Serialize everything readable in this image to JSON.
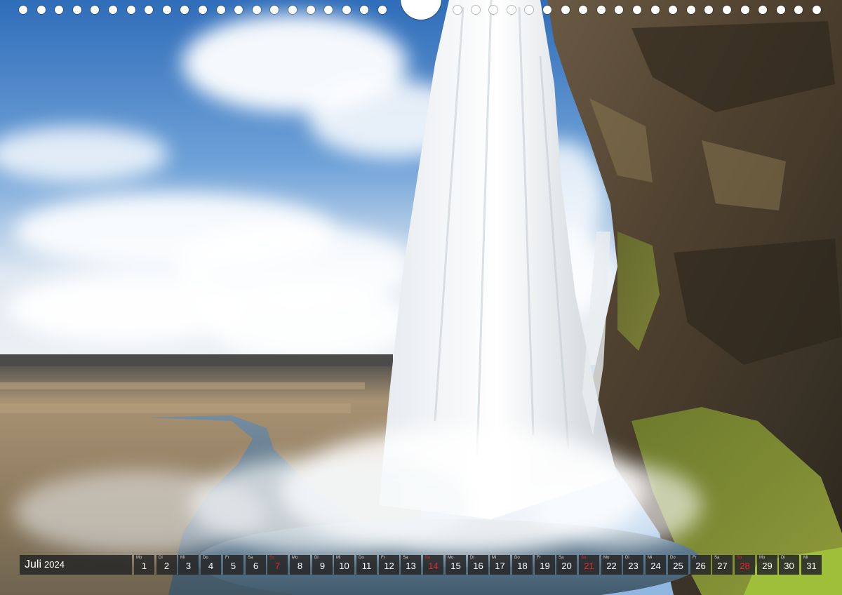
{
  "calendar": {
    "month": "Juli",
    "year": "2024",
    "days": [
      {
        "wd": "Mo",
        "d": "1"
      },
      {
        "wd": "Di",
        "d": "2"
      },
      {
        "wd": "Mi",
        "d": "3"
      },
      {
        "wd": "Do",
        "d": "4"
      },
      {
        "wd": "Fr",
        "d": "5"
      },
      {
        "wd": "Sa",
        "d": "6"
      },
      {
        "wd": "So",
        "d": "7",
        "sunday": true
      },
      {
        "wd": "Mo",
        "d": "8"
      },
      {
        "wd": "Di",
        "d": "9"
      },
      {
        "wd": "Mi",
        "d": "10"
      },
      {
        "wd": "Do",
        "d": "11"
      },
      {
        "wd": "Fr",
        "d": "12"
      },
      {
        "wd": "Sa",
        "d": "13"
      },
      {
        "wd": "So",
        "d": "14",
        "sunday": true
      },
      {
        "wd": "Mo",
        "d": "15"
      },
      {
        "wd": "Di",
        "d": "16"
      },
      {
        "wd": "Mi",
        "d": "17"
      },
      {
        "wd": "Do",
        "d": "18"
      },
      {
        "wd": "Fr",
        "d": "19"
      },
      {
        "wd": "Sa",
        "d": "20"
      },
      {
        "wd": "So",
        "d": "21",
        "sunday": true
      },
      {
        "wd": "Mo",
        "d": "22"
      },
      {
        "wd": "Di",
        "d": "23"
      },
      {
        "wd": "Mi",
        "d": "24"
      },
      {
        "wd": "Do",
        "d": "25"
      },
      {
        "wd": "Fr",
        "d": "26"
      },
      {
        "wd": "Sa",
        "d": "27"
      },
      {
        "wd": "So",
        "d": "28",
        "sunday": true
      },
      {
        "wd": "Mo",
        "d": "29"
      },
      {
        "wd": "Di",
        "d": "30"
      },
      {
        "wd": "Mi",
        "d": "31"
      }
    ]
  },
  "colors": {
    "sunday_text": "#e8262b",
    "calendar_bar": "#282828",
    "sky": "#3f7fc8",
    "rock": "#5b4a36",
    "moss": "#7f8a34"
  },
  "photo": {
    "subject_icons": [
      "waterfall",
      "cliff-rock",
      "sky-clouds",
      "river-plain"
    ]
  }
}
